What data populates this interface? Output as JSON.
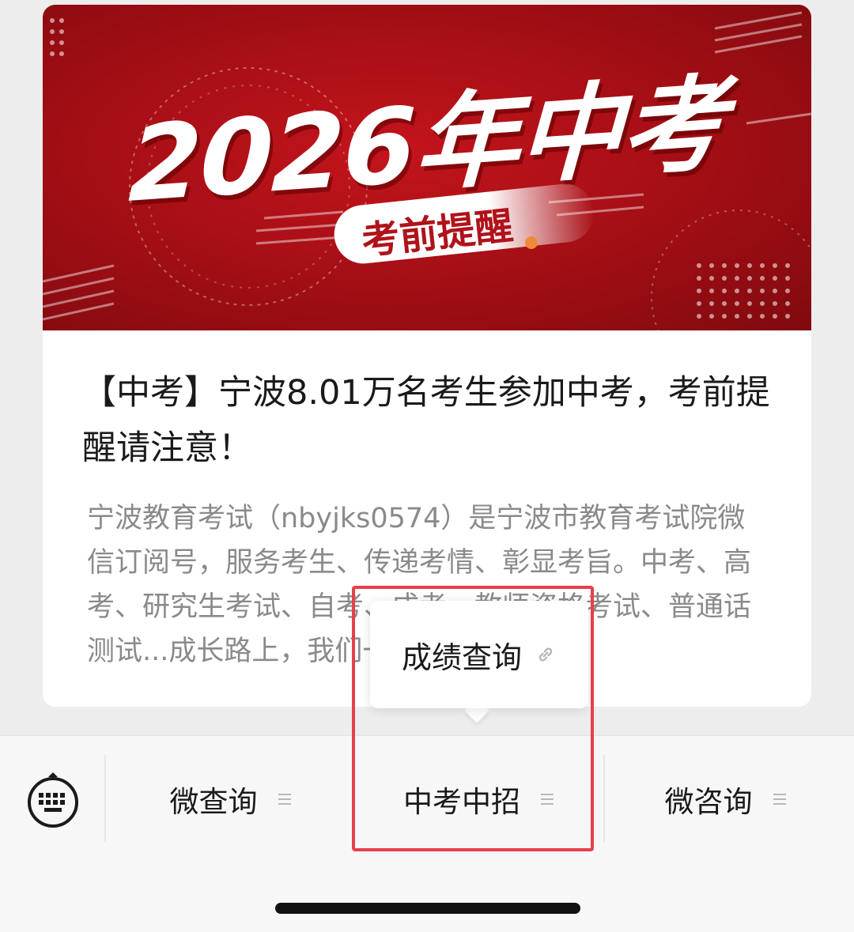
{
  "article": {
    "banner_title": "2026年中考",
    "banner_pill": "考前提醒",
    "title": "【中考】宁波8.01万名考生参加中考，考前提醒请注意！",
    "description": "宁波教育考试（nbyjks0574）是宁波市教育考试院微信订阅号，服务考生、传递考情、彰显考旨。中考、高考、研究生考试、自考、成考、教师资格考试、普通话测试...成长路上，我们一路相伴"
  },
  "popup": {
    "item_label": "成绩查询",
    "item_icon": "link-icon"
  },
  "menubar": {
    "keyboard_icon": "keyboard-icon",
    "items": [
      {
        "label": "微查询",
        "icon": "menu-lines-icon"
      },
      {
        "label": "中考中招",
        "icon": "menu-lines-icon"
      },
      {
        "label": "微咨询",
        "icon": "menu-lines-icon"
      }
    ]
  },
  "colors": {
    "banner_red": "#a10e14",
    "highlight_border": "#e6404a",
    "title_text": "#1a1a1a",
    "desc_text": "#8a8a8a"
  }
}
